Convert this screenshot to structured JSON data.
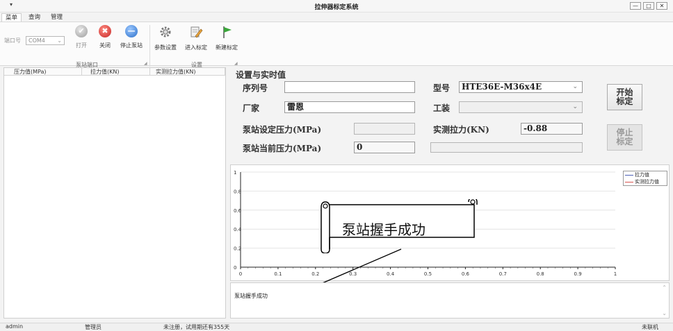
{
  "window": {
    "title": "拉伸器标定系统",
    "quick_access": "▾",
    "btn_min": "—",
    "btn_max": "□",
    "btn_close": "✕",
    "ribbon_collapse": "◇"
  },
  "menu_tabs": [
    "菜单",
    "查询",
    "管理"
  ],
  "ribbon": {
    "port_label": "端口号",
    "port_value": "COM4",
    "open_label": "打开",
    "close_label": "关闭",
    "stop_pump_label": "停止泵站",
    "params_label": "参数设置",
    "enter_calib_label": "进入标定",
    "new_calib_label": "新建标定",
    "group_pump": "泵站端口",
    "group_settings": "设置"
  },
  "table": {
    "columns": [
      "压力值(MPa)",
      "拉力值(KN)",
      "实测拉力值(KN)"
    ]
  },
  "settings": {
    "heading": "设置与实时值",
    "serial_label": "序列号",
    "serial_value": "",
    "model_label": "型号",
    "model_value": "HTE36E-M36x4E",
    "vendor_label": "厂家",
    "vendor_value": "雷恩",
    "fixture_label": "工装",
    "fixture_value": "",
    "set_pressure_label": "泵站设定压力(MPa)",
    "set_pressure_value": "",
    "measured_force_label": "实测拉力(KN)",
    "measured_force_value": "-0.88",
    "cur_pressure_label": "泵站当前压力(MPa)",
    "cur_pressure_value": "0",
    "cur_pressure_extra": "",
    "start_btn": "开始\n标定",
    "stop_btn": "停止\n标定"
  },
  "chart": {
    "yticks": [
      "1",
      "0.8",
      "0.6",
      "0.4",
      "0.2",
      "0"
    ],
    "xticks": [
      "0",
      "0.1",
      "0.2",
      "0.3",
      "0.4",
      "0.5",
      "0.6",
      "0.7",
      "0.8",
      "0.9",
      "1"
    ],
    "legend": [
      {
        "name": "拉力值",
        "color": "#4b5fb5"
      },
      {
        "name": "实测拉力值",
        "color": "#d9534f"
      }
    ]
  },
  "log": {
    "text": "泵站握手成功"
  },
  "callout": {
    "text": "泵站握手成功"
  },
  "status": {
    "user": "admin",
    "role": "管理员",
    "license": "未注册，试用期还有355天",
    "connection": "未联机"
  }
}
